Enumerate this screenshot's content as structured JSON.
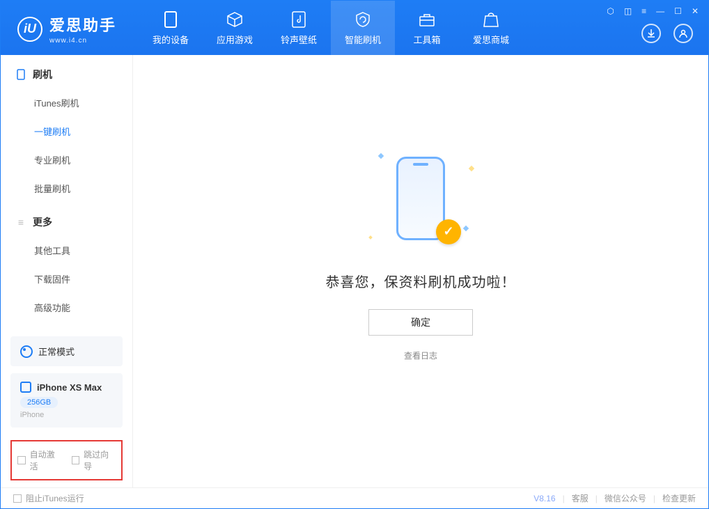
{
  "app": {
    "title": "爱思助手",
    "subtitle": "www.i4.cn"
  },
  "nav": {
    "items": [
      {
        "label": "我的设备"
      },
      {
        "label": "应用游戏"
      },
      {
        "label": "铃声壁纸"
      },
      {
        "label": "智能刷机"
      },
      {
        "label": "工具箱"
      },
      {
        "label": "爱思商城"
      }
    ]
  },
  "sidebar": {
    "section1": {
      "title": "刷机",
      "items": [
        {
          "label": "iTunes刷机"
        },
        {
          "label": "一键刷机"
        },
        {
          "label": "专业刷机"
        },
        {
          "label": "批量刷机"
        }
      ]
    },
    "section2": {
      "title": "更多",
      "items": [
        {
          "label": "其他工具"
        },
        {
          "label": "下载固件"
        },
        {
          "label": "高级功能"
        }
      ]
    },
    "mode": "正常模式",
    "device": {
      "name": "iPhone XS Max",
      "capacity": "256GB",
      "type": "iPhone"
    },
    "options": {
      "auto_activate": "自动激活",
      "skip_guide": "跳过向导"
    }
  },
  "main": {
    "success_message": "恭喜您，保资料刷机成功啦！",
    "ok_button": "确定",
    "view_log": "查看日志"
  },
  "footer": {
    "block_itunes": "阻止iTunes运行",
    "version": "V8.16",
    "links": [
      "客服",
      "微信公众号",
      "检查更新"
    ]
  }
}
